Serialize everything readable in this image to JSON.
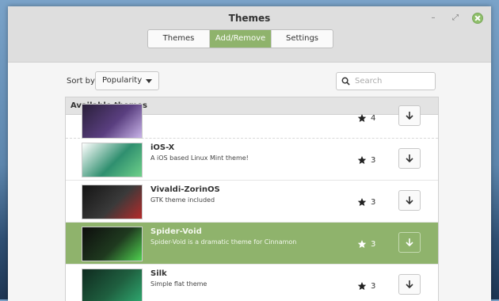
{
  "window": {
    "title": "Themes"
  },
  "tabs": [
    {
      "label": "Themes",
      "active": false
    },
    {
      "label": "Add/Remove",
      "active": true
    },
    {
      "label": "Settings",
      "active": false
    }
  ],
  "toolbar": {
    "sort_label": "Sort by",
    "sort_value": "Popularity",
    "search_placeholder": "Search"
  },
  "list": {
    "header": "Available themes",
    "items": [
      {
        "name": "",
        "description": "",
        "rating": "4",
        "thumb": [
          "#2a1f3a",
          "#5a3f80",
          "#c8b3e8"
        ]
      },
      {
        "name": "iOS-X",
        "description": "A iOS based Linux Mint theme!",
        "rating": "3",
        "thumb": [
          "#ffffff",
          "#2f8f6f",
          "#6fd18a"
        ]
      },
      {
        "name": "Vivaldi-ZorinOS",
        "description": "GTK theme included",
        "rating": "3",
        "thumb": [
          "#141414",
          "#3a3a3a",
          "#b52a2a"
        ]
      },
      {
        "name": "Spider-Void",
        "description": "Spider-Void is a dramatic theme for Cinnamon",
        "rating": "3",
        "thumb": [
          "#0d0d0d",
          "#1f3a1f",
          "#4fd14f"
        ]
      },
      {
        "name": "Silk",
        "description": "Simple flat theme",
        "rating": "3",
        "thumb": [
          "#0f2a1f",
          "#1f5f3f",
          "#2fa86f"
        ]
      }
    ]
  },
  "colors": {
    "accent": "#8fb36c",
    "titlebar": "#dedede",
    "window_bg": "#f5f5f5"
  }
}
